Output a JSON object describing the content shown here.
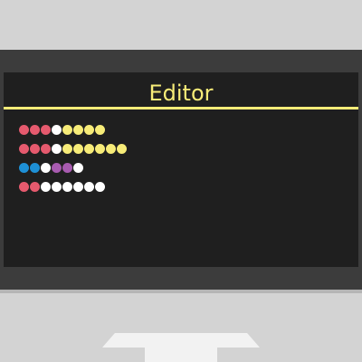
{
  "editor": {
    "title": "Editor"
  },
  "colors": {
    "title": "#f7ec78",
    "red": "#e65a6e",
    "yellow": "#f7ec78",
    "white": "#ffffff",
    "blue": "#1e90d6",
    "purple": "#a85bb0"
  },
  "rows": [
    [
      "red",
      "red",
      "red",
      "white",
      "yellow",
      "yellow",
      "yellow",
      "yellow"
    ],
    [
      "red",
      "red",
      "red",
      "white",
      "yellow",
      "yellow",
      "yellow",
      "yellow",
      "yellow",
      "yellow"
    ],
    [
      "blue",
      "blue",
      "white",
      "purple",
      "purple",
      "white"
    ],
    [
      "red",
      "red",
      "white",
      "white",
      "white",
      "white",
      "white",
      "white"
    ]
  ]
}
